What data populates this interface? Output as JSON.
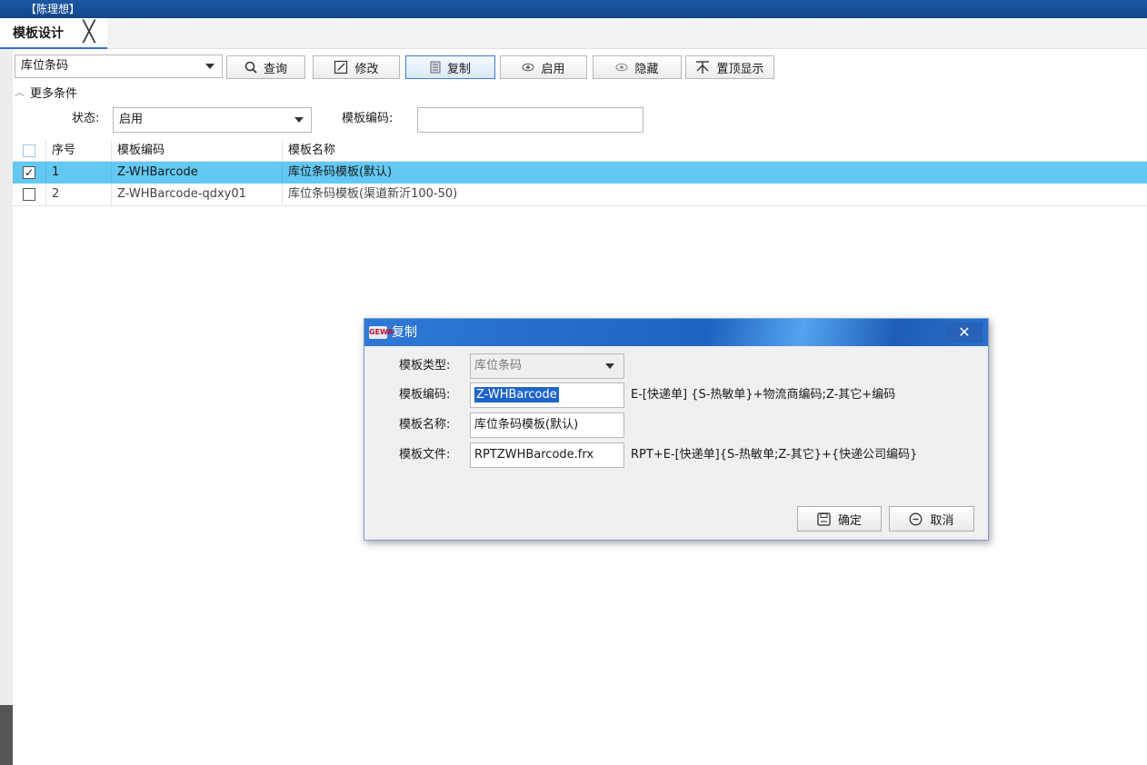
{
  "window": {
    "title": "【陈理想】"
  },
  "doc_tab": {
    "label": "模板设计",
    "close_glyph": "╳"
  },
  "toolbar": {
    "type_combo_value": "库位条码",
    "query_label": "查询",
    "edit_label": "修改",
    "copy_label": "复制",
    "enable_label": "启用",
    "hide_label": "隐藏",
    "top_label": "置顶显示",
    "icons": [
      "search-icon",
      "edit-icon",
      "copy-icon",
      "eye-icon",
      "eye-off-icon",
      "pin-top-icon"
    ]
  },
  "filters": {
    "more_label": "更多条件",
    "status_label": "状态:",
    "status_value": "启用",
    "code_label": "模板编码:",
    "code_value": ""
  },
  "grid": {
    "columns": [
      "序号",
      "模板编码",
      "模板名称"
    ],
    "rows": [
      {
        "checked": true,
        "index": "1",
        "code": "Z-WHBarcode",
        "name": "库位条码模板(默认)"
      },
      {
        "checked": false,
        "index": "2",
        "code": "Z-WHBarcode-qdxy01",
        "name": "库位条码模板(渠道新沂100-50)"
      }
    ],
    "check_mark": "✓",
    "selected_color": "#63c9f3"
  },
  "dialog": {
    "title": "复制",
    "logo_text": "GEWA",
    "close_glyph": "✕",
    "type_label": "模板类型:",
    "type_value": "库位条码",
    "code_label": "模板编码:",
    "code_value": "Z-WHBarcode",
    "code_hint": "E-[快递单] {S-热敏单}+物流商编码;Z-其它+编码",
    "name_label": "模板名称:",
    "name_value": "库位条码模板(默认)",
    "file_label": "模板文件:",
    "file_value": "RPTZWHBarcode.frx",
    "file_hint": "RPT+E-[快递单]{S-热敏单;Z-其它}+{快递公司编码}",
    "ok_label": "确定",
    "cancel_label": "取消"
  },
  "colors": {
    "titlebar": "#12458c",
    "accent": "#2f6fd3",
    "selection": "#63c9f3"
  }
}
